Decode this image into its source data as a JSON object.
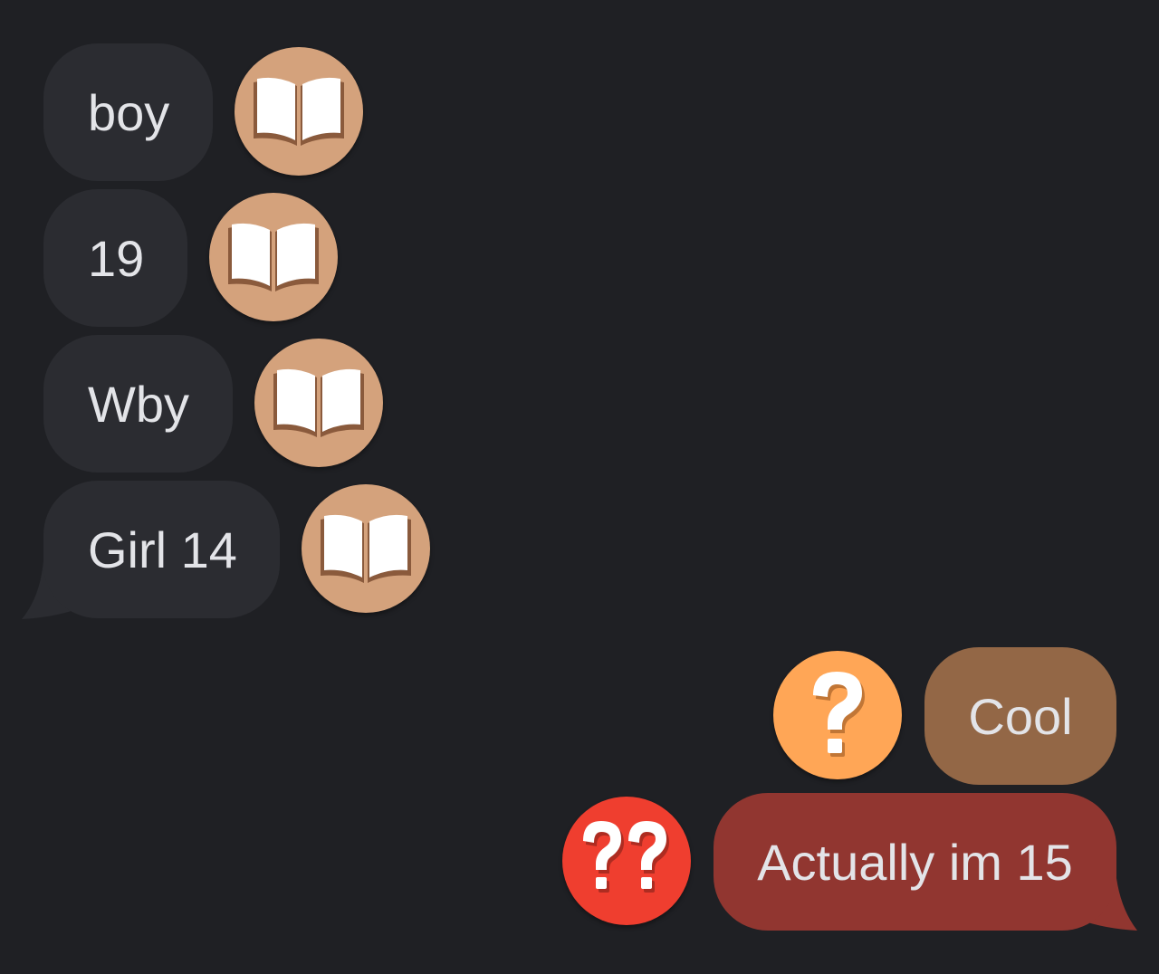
{
  "colors": {
    "background": "#1f2024",
    "incoming_bubble": "#2b2c31",
    "incoming_text": "#e3e4e8",
    "book_reaction_bg": "#d4a27c",
    "question_reaction_bg": "#ffa656",
    "double_question_reaction_bg": "#ef3e2f",
    "outgoing_cool_bubble": "#936746",
    "outgoing_actually_bubble": "#913630"
  },
  "messages": [
    {
      "sender": "other",
      "text": "boy",
      "reaction": "open-book-icon"
    },
    {
      "sender": "other",
      "text": "19",
      "reaction": "open-book-icon"
    },
    {
      "sender": "other",
      "text": "Wby",
      "reaction": "open-book-icon"
    },
    {
      "sender": "other",
      "text": "Girl 14",
      "reaction": "open-book-icon"
    },
    {
      "sender": "me",
      "text": "Cool",
      "reaction": "question-mark-icon"
    },
    {
      "sender": "me",
      "text": "Actually im 15",
      "reaction": "double-question-mark-icon"
    }
  ]
}
